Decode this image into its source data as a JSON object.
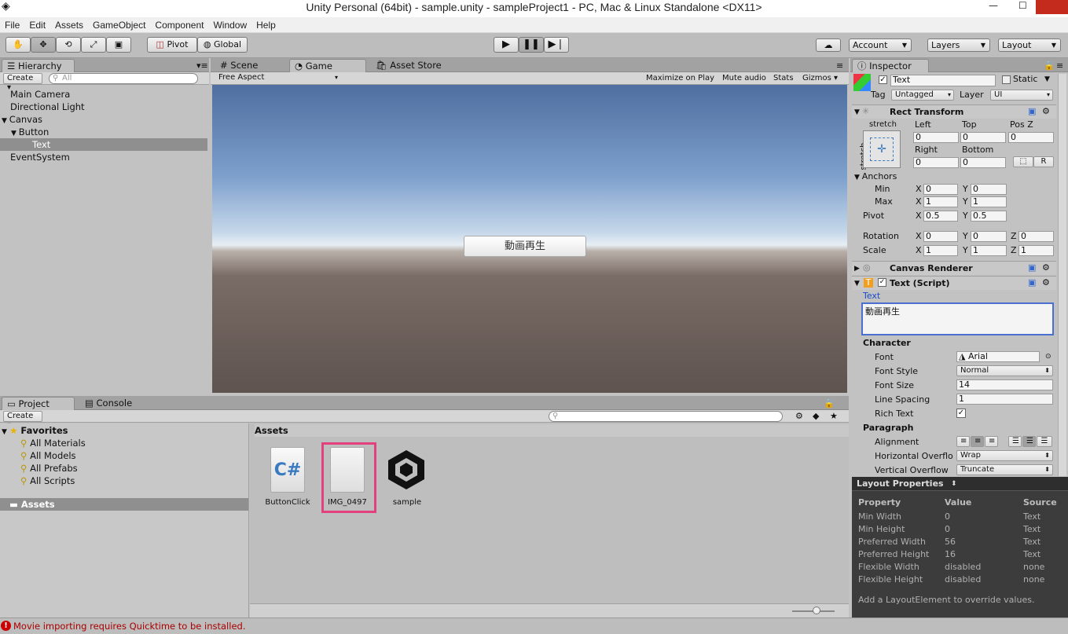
{
  "title": "Unity Personal (64bit) - sample.unity - sampleProject1 - PC, Mac & Linux Standalone <DX11>",
  "menu": [
    "File",
    "Edit",
    "Assets",
    "GameObject",
    "Component",
    "Window",
    "Help"
  ],
  "toolbar": {
    "pivot": "Pivot",
    "global": "Global",
    "account": "Account",
    "layers": "Layers",
    "layout": "Layout"
  },
  "hierarchy": {
    "tab": "Hierarchy",
    "create": "Create",
    "search_placeholder": "All",
    "items": [
      "Main Camera",
      "Directional Light",
      "Canvas",
      "Button",
      "Text",
      "EventSystem"
    ]
  },
  "center_tabs": {
    "scene": "Scene",
    "game": "Game",
    "store": "Asset Store"
  },
  "game": {
    "aspect": "Free Aspect",
    "maximize": "Maximize on Play",
    "mute": "Mute audio",
    "stats": "Stats",
    "gizmos": "Gizmos",
    "button_text": "動画再生"
  },
  "project": {
    "tab": "Project",
    "console": "Console",
    "create": "Create",
    "favorites": "Favorites",
    "fav_items": [
      "All Materials",
      "All Models",
      "All Prefabs",
      "All Scripts"
    ],
    "assets_root": "Assets",
    "assets_header": "Assets",
    "assets": [
      "ButtonClick",
      "IMG_0497",
      "sample"
    ]
  },
  "inspector": {
    "tab": "Inspector",
    "name": "Text",
    "static": "Static",
    "tag_label": "Tag",
    "tag": "Untagged",
    "layer_label": "Layer",
    "layer": "UI",
    "rect_title": "Rect Transform",
    "stretch": "stretch",
    "left": "Left",
    "top": "Top",
    "posz": "Pos Z",
    "left_v": "0",
    "top_v": "0",
    "posz_v": "0",
    "right": "Right",
    "bottom": "Bottom",
    "right_v": "0",
    "bottom_v": "0",
    "r_btn": "R",
    "anchors": "Anchors",
    "min": "Min",
    "max": "Max",
    "pivot": "Pivot",
    "min_x": "0",
    "min_y": "0",
    "max_x": "1",
    "max_y": "1",
    "pivot_x": "0.5",
    "pivot_y": "0.5",
    "rotation": "Rotation",
    "scale": "Scale",
    "rot_x": "0",
    "rot_y": "0",
    "rot_z": "0",
    "scale_x": "1",
    "scale_y": "1",
    "scale_z": "1",
    "x": "X",
    "y": "Y",
    "z": "Z",
    "canvas_renderer": "Canvas Renderer",
    "text_script": "Text (Script)",
    "text_label": "Text",
    "text_value": "動画再生",
    "character": "Character",
    "font": "Font",
    "font_v": "Arial",
    "font_style": "Font Style",
    "font_style_v": "Normal",
    "font_size": "Font Size",
    "font_size_v": "14",
    "line_spacing": "Line Spacing",
    "line_spacing_v": "1",
    "rich_text": "Rich Text",
    "paragraph": "Paragraph",
    "alignment": "Alignment",
    "h_overflow": "Horizontal Overflo",
    "h_overflow_v": "Wrap",
    "v_overflow": "Vertical Overflow",
    "v_overflow_v": "Truncate"
  },
  "layout_props": {
    "title": "Layout Properties",
    "headers": [
      "Property",
      "Value",
      "Source"
    ],
    "rows": [
      [
        "Min Width",
        "0",
        "Text"
      ],
      [
        "Min Height",
        "0",
        "Text"
      ],
      [
        "Preferred Width",
        "56",
        "Text"
      ],
      [
        "Preferred Height",
        "16",
        "Text"
      ],
      [
        "Flexible Width",
        "disabled",
        "none"
      ],
      [
        "Flexible Height",
        "disabled",
        "none"
      ]
    ],
    "footer": "Add a LayoutElement to override values."
  },
  "status": "Movie importing requires Quicktime to be installed."
}
